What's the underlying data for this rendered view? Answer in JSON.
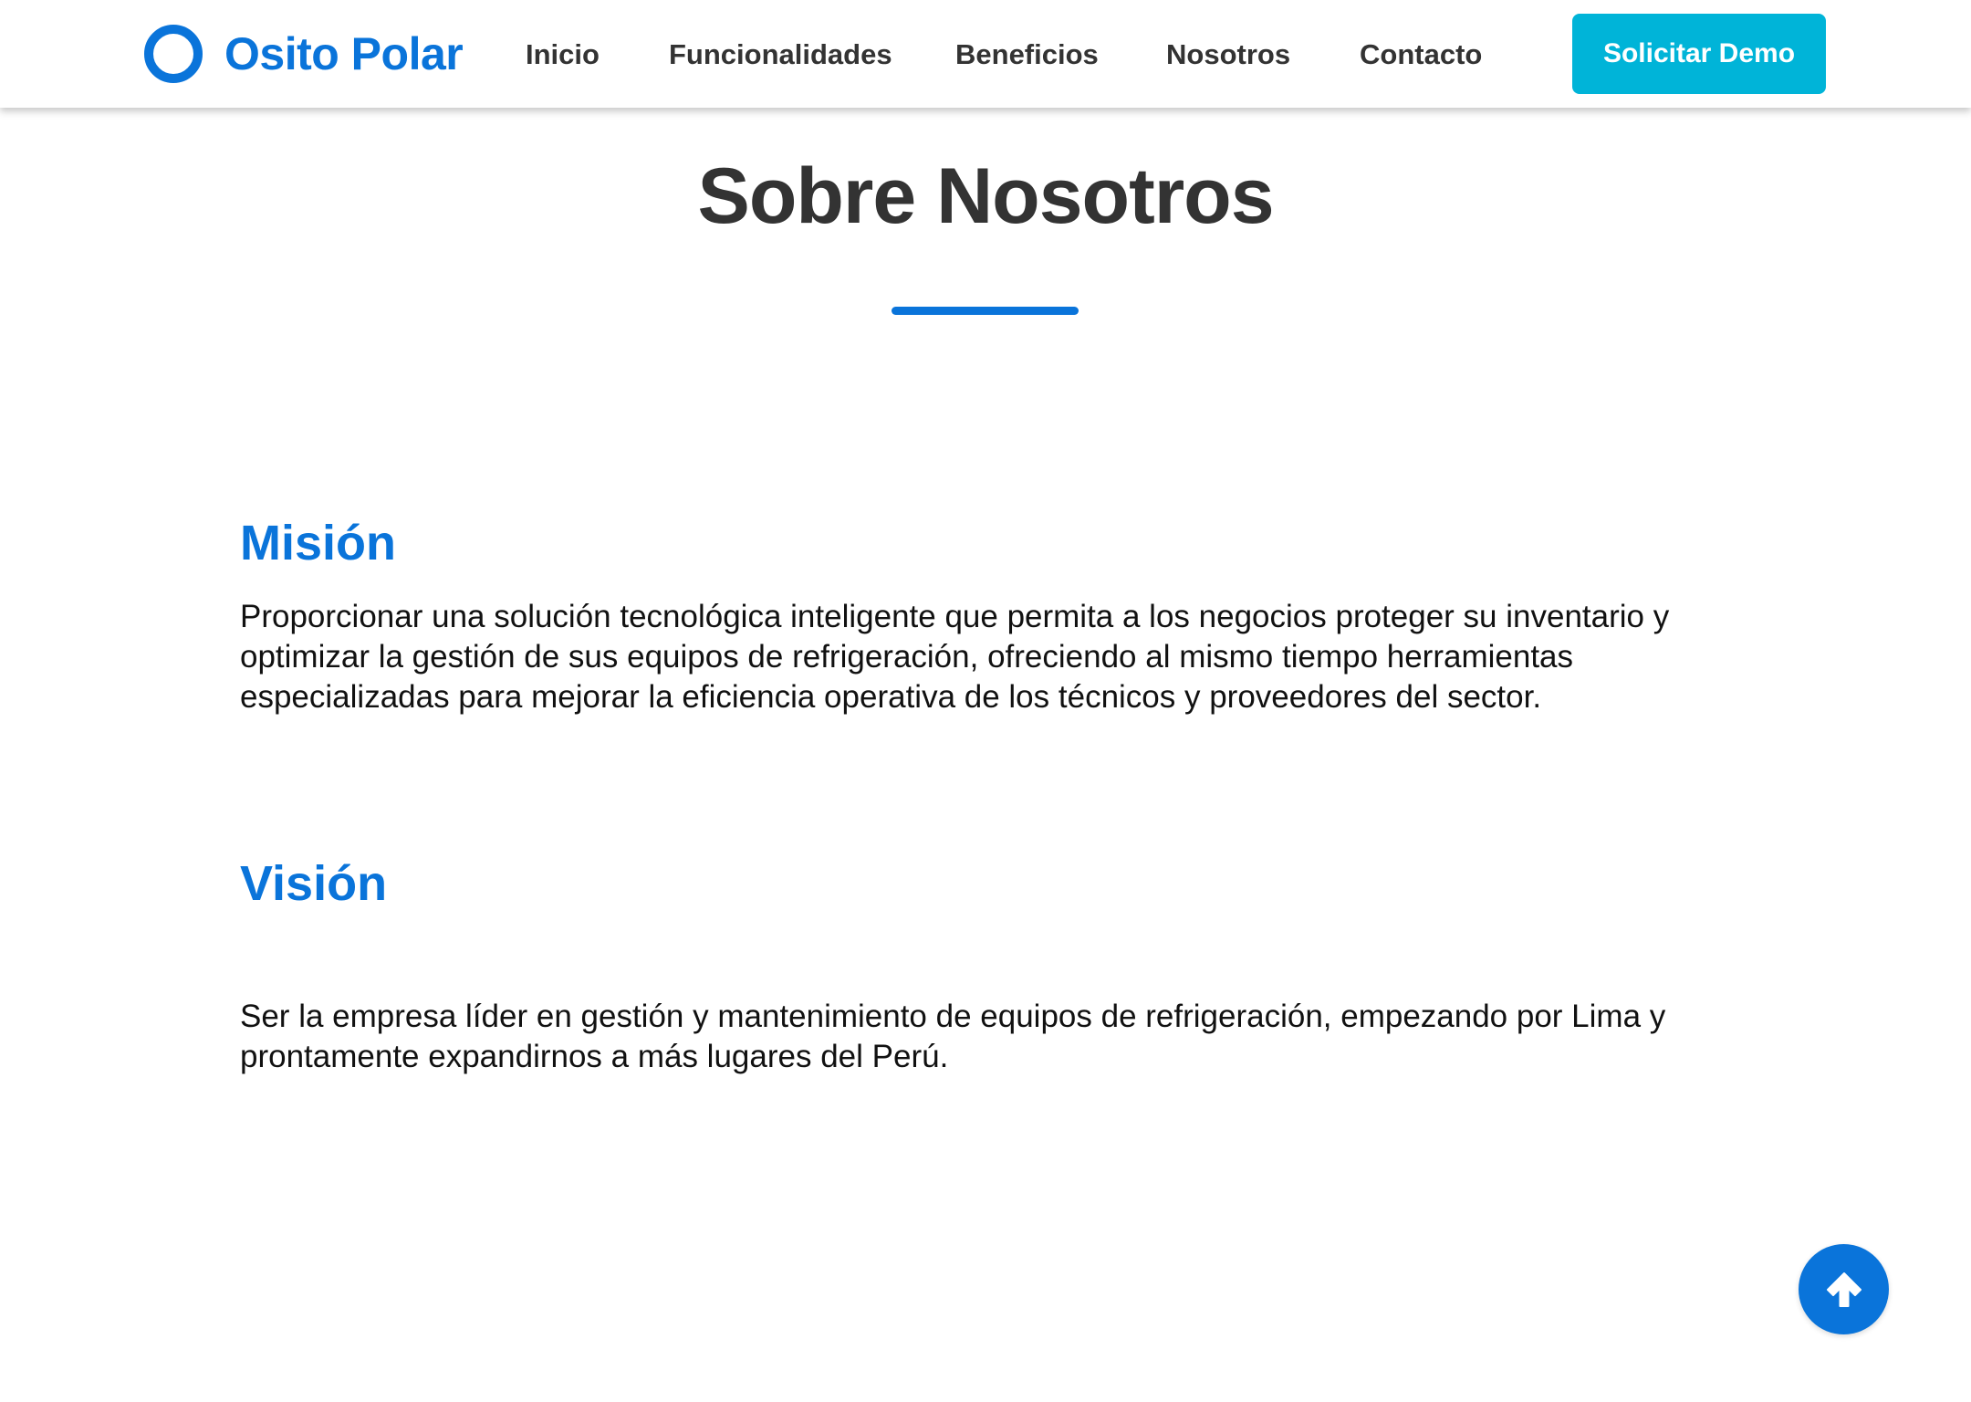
{
  "brand": {
    "name": "Osito Polar",
    "logo_icon": "ring-logo-icon",
    "color": "#0a74da"
  },
  "nav": {
    "items": [
      {
        "label": "Inicio"
      },
      {
        "label": "Funcionalidades"
      },
      {
        "label": "Beneficios"
      },
      {
        "label": "Nosotros"
      },
      {
        "label": "Contacto"
      }
    ],
    "cta_label": "Solicitar Demo",
    "cta_color": "#00b4d8"
  },
  "about": {
    "title": "Sobre Nosotros",
    "mision": {
      "heading": "Misión",
      "text": "Proporcionar una solución tecnológica inteligente que permita a los negocios proteger su inventario y optimizar la gestión de sus equipos de refrigeración, ofreciendo al mismo tiempo herramientas especializadas para mejorar la eficiencia operativa de los técnicos y proveedores del sector."
    },
    "vision": {
      "heading": "Visión",
      "text": "Ser la empresa líder en gestión y mantenimiento de equipos de refrigeración, empezando por Lima y prontamente expandirnos a más lugares del Perú."
    }
  },
  "scroll_top": {
    "icon": "arrow-up-icon"
  }
}
